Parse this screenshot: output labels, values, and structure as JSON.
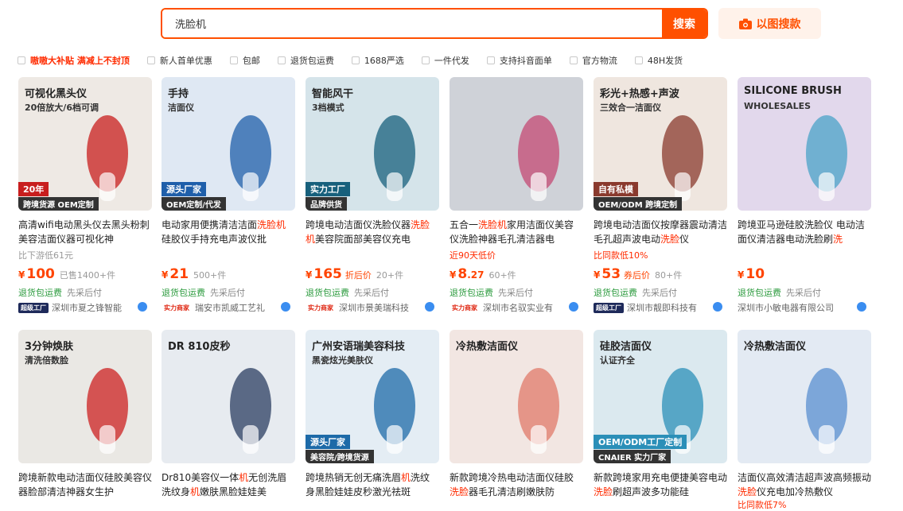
{
  "search": {
    "query": "洗脸机",
    "button_label": "搜索",
    "image_search_label": "以图搜款"
  },
  "filters": [
    {
      "label": "嗷嗷大补贴 满减上不封顶",
      "highlight": true
    },
    {
      "label": "新人首单优惠",
      "highlight": false
    },
    {
      "label": "包邮",
      "highlight": false
    },
    {
      "label": "退货包运费",
      "highlight": false
    },
    {
      "label": "1688严选",
      "highlight": false
    },
    {
      "label": "一件代发",
      "highlight": false
    },
    {
      "label": "支持抖音面单",
      "highlight": false
    },
    {
      "label": "官方物流",
      "highlight": false
    },
    {
      "label": "48H发货",
      "highlight": false
    }
  ],
  "products": [
    {
      "title_a": "高清wifi电动黑头仪去黑头粉刺美容洁面仪器可视化神",
      "title_kw": "",
      "title_b": "",
      "sub": "比下游低61元",
      "sub_red": false,
      "currency": "¥",
      "price": "100",
      "price_dec": "",
      "price_tag": "",
      "sold": "已售1400+件",
      "svc1": "退货包运费",
      "svc2": "先采后付",
      "badge": "超级工厂",
      "badge_type": "super",
      "shop": "深圳市夏之锋智能",
      "img": {
        "bg": "#eee9e4",
        "t1": "可视化黑头仪",
        "t2": "20倍放大/6档可调",
        "t3": "20年",
        "t4": "跨境货源 OEM定制",
        "accent": "#c81e1e"
      }
    },
    {
      "title_a": "电动家用便携清洁洁面",
      "title_kw": "洗脸机",
      "title_b": "硅胶仪手持充电声波仪批",
      "sub": "",
      "sub_red": false,
      "currency": "¥",
      "price": "21",
      "price_dec": "",
      "price_tag": "",
      "sold": "500+件",
      "svc1": "退货包运费",
      "svc2": "先采后付",
      "badge": "实力商家",
      "badge_type": "strong",
      "shop": "瑞安市凯威工艺礼",
      "img": {
        "bg": "#dfe8f3",
        "t1": "手持",
        "t2": "洁面仪",
        "t3": "源头厂家",
        "t4": "OEM定制/代发",
        "accent": "#1f5faa"
      }
    },
    {
      "title_a": "跨境电动洁面仪洗脸仪器",
      "title_kw": "洗脸机",
      "title_b": "美容院面部美容仪充电",
      "sub": "",
      "sub_red": false,
      "currency": "¥",
      "price": "165",
      "price_dec": "",
      "price_tag": "折后价",
      "sold": "20+件",
      "svc1": "退货包运费",
      "svc2": "先采后付",
      "badge": "实力商家",
      "badge_type": "strong",
      "shop": "深圳市景美瑞科技",
      "img": {
        "bg": "#d5e4ea",
        "t1": "智能风干",
        "t2": "3档模式",
        "t3": "实力工厂",
        "t4": "品牌供货",
        "accent": "#17607c"
      }
    },
    {
      "title_a": "五合一",
      "title_kw": "洗脸机",
      "title_b": "家用洁面仪美容仪洗脸神器毛孔清洁器电",
      "sub": "近90天低价",
      "sub_red": true,
      "currency": "¥",
      "price": "8",
      "price_dec": ".27",
      "price_tag": "",
      "sold": "60+件",
      "svc1": "退货包运费",
      "svc2": "先采后付",
      "badge": "实力商家",
      "badge_type": "strong",
      "shop": "深圳市名驭实业有",
      "img": {
        "bg": "#cfd2d8",
        "t1": "",
        "t2": "",
        "t3": "",
        "t4": "",
        "accent": "#c44a74"
      }
    },
    {
      "title_a": "跨境电动洁面仪按摩器震动清洁毛孔超声波电动",
      "title_kw": "洗脸",
      "title_b": "仪",
      "sub": "比同款低10%",
      "sub_red": true,
      "currency": "¥",
      "price": "53",
      "price_dec": "",
      "price_tag": "券后价",
      "sold": "80+件",
      "svc1": "退货包运费",
      "svc2": "先采后付",
      "badge": "超级工厂",
      "badge_type": "super",
      "shop": "深圳市靓即科技有",
      "img": {
        "bg": "#efe6df",
        "t1": "彩光+热感+声波",
        "t2": "三效合一洁面仪",
        "t3": "自有私模",
        "t4": "OEM/ODM 跨境定制",
        "accent": "#8a3a2e"
      }
    },
    {
      "title_a": "跨境亚马逊硅胶洗脸仪 电动洁面仪清洁器电动洗脸刷",
      "title_kw": "洗",
      "title_b": "",
      "sub": "",
      "sub_red": false,
      "currency": "¥",
      "price": "10",
      "price_dec": "",
      "price_tag": "",
      "sold": "",
      "svc1": "退货包运费",
      "svc2": "先采后付",
      "badge": "",
      "badge_type": "",
      "shop": "深圳市小敏电器有限公司",
      "img": {
        "bg": "#e2d8ec",
        "t1": "SILICONE BRUSH",
        "t2": "WHOLESALES",
        "t3": "",
        "t4": "",
        "accent": "#4aa3c8"
      }
    },
    {
      "title_a": "跨境新款电动洁面仪硅胶美容仪器脸部清洁神器女生护",
      "title_kw": "",
      "title_b": "",
      "img": {
        "bg": "#eae8e4",
        "t1": "3分钟焕肤",
        "t2": "清洗倍数脸",
        "t3": "",
        "t4": "",
        "accent": "#c22"
      }
    },
    {
      "title_a": "Dr810美容仪一体",
      "title_kw": "机",
      "title_b": "无创洗眉洗纹身",
      "title_kw2": "机",
      "title_c": "嫩肤黑脸娃娃美",
      "img": {
        "bg": "#e7ebf0",
        "t1": "DR 810皮秒",
        "t2": "",
        "t3": "",
        "t4": "",
        "accent": "#2b3d61"
      }
    },
    {
      "title_a": "跨境热销无创无痛洗眉",
      "title_kw": "机",
      "title_b": "洗纹身黑脸娃娃皮秒激光祛斑",
      "img": {
        "bg": "#e4edf4",
        "t1": "广州安语瑞美容科技",
        "t2": "黑瓷炫光美肤仪",
        "t3": "源头厂家",
        "t4": "美容院/跨境货源",
        "accent": "#1d6aa8"
      }
    },
    {
      "title_a": "新款跨境冷热电动洁面仪硅胶",
      "title_kw": "洗脸",
      "title_b": "器毛孔清洁刷嫩肤防",
      "img": {
        "bg": "#f2e6e2",
        "t1": "冷热敷洁面仪",
        "t2": "",
        "t3": "",
        "t4": "",
        "accent": "#e07a6a"
      }
    },
    {
      "title_a": "新款跨境家用充电便捷美容电动",
      "title_kw": "洗脸",
      "title_b": "刷超声波多功能硅",
      "img": {
        "bg": "#dbe9ef",
        "t1": "硅胶洁面仪",
        "t2": "认证齐全",
        "t3": "OEM/ODM工厂定制",
        "t4": "CNAIER 实力厂家",
        "accent": "#2b8fb8"
      }
    },
    {
      "title_a": "洁面仪高效清洁超声波高频振动",
      "title_kw": "洗脸",
      "title_b": "仪充电加冷热敷仪",
      "sub": "比同款低7%",
      "img": {
        "bg": "#e3eaf3",
        "t1": "冷热敷洁面仪",
        "t2": "",
        "t3": "",
        "t4": "",
        "accent": "#5a8fd0"
      }
    }
  ]
}
